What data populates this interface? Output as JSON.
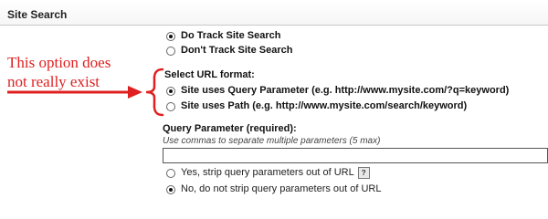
{
  "section": {
    "title": "Site Search"
  },
  "tracking": {
    "options": [
      {
        "label": "Do Track Site Search",
        "checked": true
      },
      {
        "label": "Don't Track Site Search",
        "checked": false
      }
    ]
  },
  "url_format": {
    "heading": "Select URL format:",
    "options": [
      {
        "label": "Site uses Query Parameter (e.g. http://www.mysite.com/?q=keyword)",
        "checked": true
      },
      {
        "label": "Site uses Path (e.g. http://www.mysite.com/search/keyword)",
        "checked": false
      }
    ]
  },
  "query_parameter": {
    "label": "Query Parameter (required):",
    "hint": "Use commas to separate multiple parameters (5 max)",
    "value": ""
  },
  "strip_options": {
    "options": [
      {
        "label": "Yes, strip query parameters out of URL",
        "checked": false,
        "help_icon": "question-mark-icon"
      },
      {
        "label": "No, do not strip query parameters out of URL",
        "checked": true
      }
    ],
    "help_glyph": "?"
  },
  "annotation": {
    "line1": "This option does",
    "line2": "not really exist",
    "color": "#e02020"
  }
}
